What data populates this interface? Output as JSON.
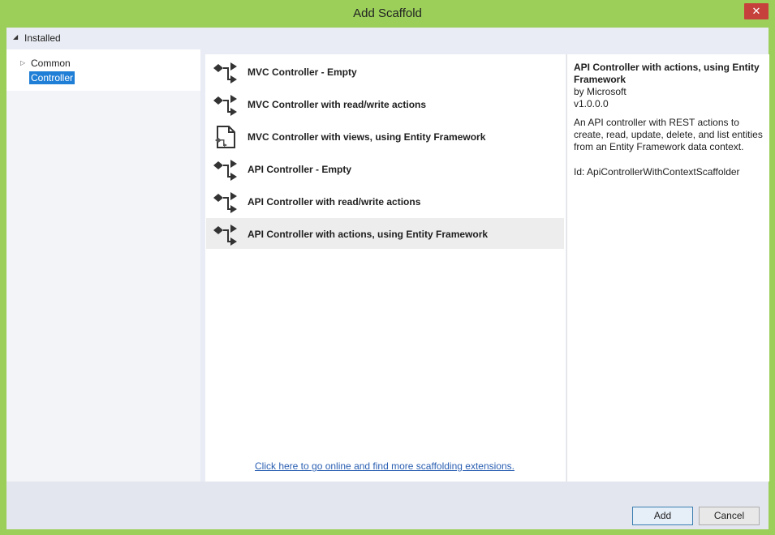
{
  "window": {
    "title": "Add Scaffold",
    "close_glyph": "✕"
  },
  "installed": {
    "label": "Installed",
    "expand_glyph": "◢"
  },
  "tree": {
    "items": [
      {
        "label": "Common",
        "glyph": "▷"
      },
      {
        "label": "Controller"
      }
    ]
  },
  "scaffolds": [
    {
      "label": "MVC Controller - Empty",
      "icon": "controller-icon"
    },
    {
      "label": "MVC Controller with read/write actions",
      "icon": "controller-icon"
    },
    {
      "label": "MVC Controller with views, using Entity Framework",
      "icon": "view-page-icon"
    },
    {
      "label": "API Controller - Empty",
      "icon": "controller-icon"
    },
    {
      "label": "API Controller with read/write actions",
      "icon": "controller-icon"
    },
    {
      "label": "API Controller with actions, using Entity Framework",
      "icon": "controller-icon",
      "selected": true
    }
  ],
  "online_link": "Click here to go online and find more scaffolding extensions.",
  "details": {
    "title": "API Controller with actions, using Entity Framework",
    "author": "by Microsoft",
    "version": "v1.0.0.0",
    "description": "An API controller with REST actions to create, read, update, delete, and list entities from an Entity Framework data context.",
    "id": "Id: ApiControllerWithContextScaffolder"
  },
  "buttons": {
    "add": "Add",
    "cancel": "Cancel"
  },
  "colors": {
    "window_frame": "#9bcf5a",
    "selection": "#1f7ed6",
    "link": "#2a5fb2",
    "close": "#c7413c"
  }
}
